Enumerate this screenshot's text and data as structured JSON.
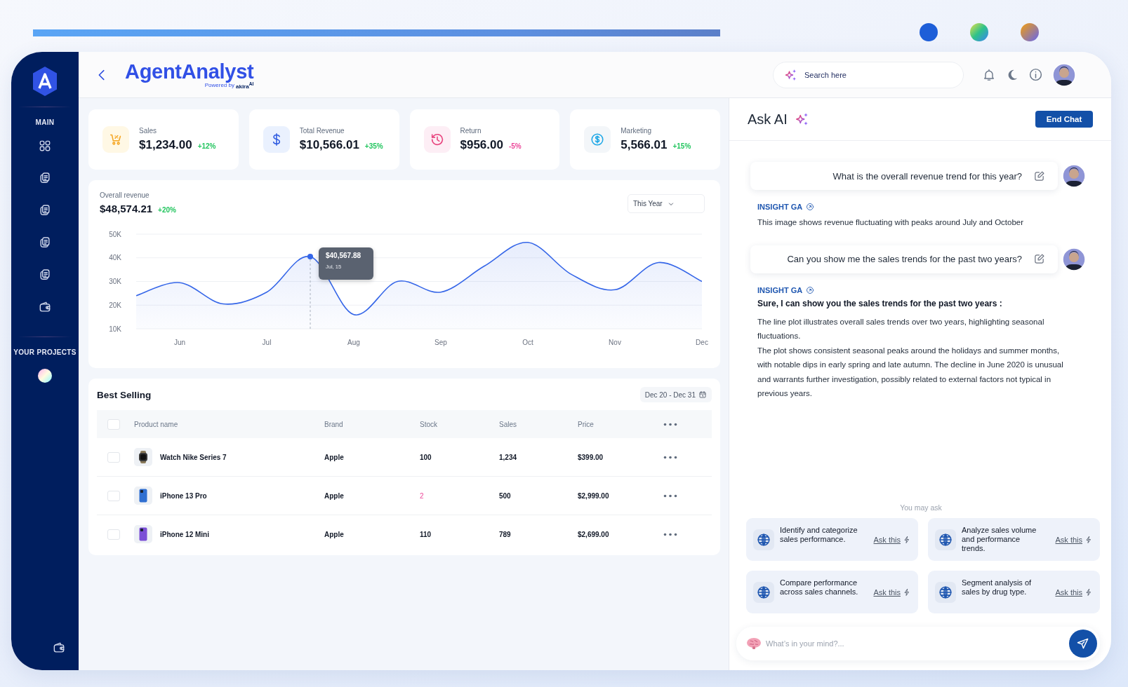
{
  "sidebar": {
    "sections": [
      {
        "title": "MAIN",
        "items": [
          {
            "kind": "grid"
          },
          {
            "kind": "doc"
          },
          {
            "kind": "doc"
          },
          {
            "kind": "doc"
          },
          {
            "kind": "doc"
          },
          {
            "kind": "wallet"
          }
        ]
      },
      {
        "title": "YOUR PROJECTS",
        "items": [
          {
            "kind": "orb"
          }
        ]
      }
    ],
    "footer": [
      {
        "kind": "wallet"
      }
    ]
  },
  "header": {
    "title": "AgentAnalyst",
    "powered_by": "Powered by",
    "brand": "akira$^{AI}$",
    "search": {
      "placeholder": "Search here"
    }
  },
  "stats": [
    {
      "kind": "cart",
      "label": "Sales",
      "value": "$1,234.00",
      "change": "+12%",
      "color": "#22c55e"
    },
    {
      "kind": "dollar",
      "label": "Total Revenue",
      "value": "$10,566.01",
      "change": "+35%",
      "color": "#22c55e"
    },
    {
      "kind": "history",
      "label": "Return",
      "value": "$956.00",
      "change": "-5%",
      "color": "#ec4899"
    },
    {
      "kind": "coin",
      "label": "Marketing",
      "value": "5,566.01",
      "change": "+15%",
      "color": "#22c55e"
    }
  ],
  "revenue": {
    "label": "Overall revenue",
    "value": "$48,574.21",
    "change": "+20%",
    "period": "This Year",
    "tooltip_date": "Jul, 15",
    "chart_data": {
      "type": "area",
      "categories": [
        null,
        "Jun",
        null,
        "Jul",
        null,
        "Aug",
        null,
        "Sep",
        null,
        "Oct",
        null,
        "Nov",
        null,
        "Dec"
      ],
      "series": [
        {
          "color": "#3566e8",
          "values": [
            24000,
            29500,
            20500,
            25500,
            40500,
            16000,
            30000,
            25500,
            36500,
            46500,
            33000,
            26500,
            38000,
            30000
          ]
        }
      ],
      "yticks": [
        {
          "value": 50000,
          "label": "50K"
        },
        {
          "value": 40000,
          "label": "40K"
        },
        {
          "value": 30000,
          "label": "30K"
        },
        {
          "value": 20000,
          "label": "20K"
        },
        {
          "value": 10000,
          "label": "10K"
        }
      ],
      "ylim": [
        10000,
        50000
      ],
      "grid": true,
      "annotations": [
        "$40,567.88"
      ]
    }
  },
  "best_selling": {
    "title": "Best Selling",
    "date_range": "Dec 20 - Dec 31",
    "all_checked": false,
    "columns": [
      "Product name",
      "Brand",
      "Stock",
      "Sales",
      "Price"
    ],
    "rows": [
      {
        "checked": false,
        "kind": "watch",
        "color": "#3a3a3a",
        "product": "Watch Nike Series 7",
        "brand": "Apple",
        "stock": "100",
        "low_stock": false,
        "sales": "1,234",
        "price": "$399.00"
      },
      {
        "checked": false,
        "kind": "phone",
        "color": "#2f6fd1",
        "product": "iPhone 13 Pro",
        "brand": "Apple",
        "stock": "2",
        "low_stock": true,
        "sales": "500",
        "price": "$2,999.00"
      },
      {
        "checked": false,
        "kind": "phone",
        "color": "#7b4fd6",
        "product": "iPhone 12 Mini",
        "brand": "Apple",
        "stock": "110",
        "low_stock": false,
        "sales": "789",
        "price": "$2,699.00"
      }
    ]
  },
  "chat": {
    "title": "Ask AI",
    "end_button": "End Chat",
    "messages": [
      {
        "kind": "user",
        "text": "What is the overall revenue trend for this year?"
      },
      {
        "kind": "assistant",
        "label": "INSIGHT GA",
        "paragraphs": [
          "This image shows revenue fluctuating with peaks around July and October"
        ]
      },
      {
        "kind": "user",
        "text": "Can you show me the sales trends for the past two years?"
      },
      {
        "kind": "assistant",
        "label": "INSIGHT GA",
        "heading": "Sure, I can show you the sales trends for the past two years :",
        "paragraphs": [
          "The line plot illustrates overall sales trends over two years, highlighting seasonal fluctuations.",
          "The plot shows consistent seasonal peaks around the holidays and summer months, with notable dips in early spring and late autumn. The decline in June 2020 is unusual and warrants further investigation, possibly related to external factors not typical in previous years."
        ]
      }
    ],
    "suggestions_label": "You may ask",
    "suggestions": [
      {
        "text": "Identify and categorize sales performance.",
        "action": "Ask this"
      },
      {
        "text": "Analyze sales volume and performance trends.",
        "action": "Ask this"
      },
      {
        "text": "Compare performance across sales channels.",
        "action": "Ask this"
      },
      {
        "text": "Segment analysis of sales by drug type.",
        "action": "Ask this"
      }
    ],
    "input": {
      "placeholder": "What’s in your mind?..."
    }
  }
}
